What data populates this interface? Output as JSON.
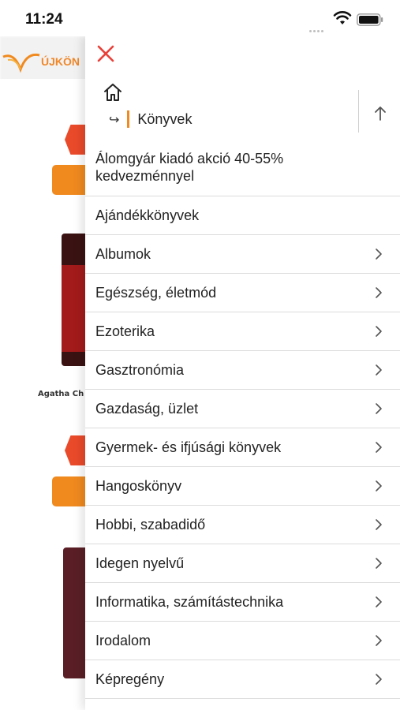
{
  "status_bar": {
    "time": "11:24"
  },
  "background": {
    "logo_text": "ÚJKÖN",
    "product_author": "Agatha Ch"
  },
  "drawer": {
    "breadcrumb": {
      "current": "Könyvek"
    },
    "categories": [
      {
        "label": "Álomgyár kiadó akció 40-55% kedvezménnyel",
        "has_children": false
      },
      {
        "label": "Ajándékkönyvek",
        "has_children": false
      },
      {
        "label": "Albumok",
        "has_children": true
      },
      {
        "label": "Egészség, életmód",
        "has_children": true
      },
      {
        "label": "Ezoterika",
        "has_children": true
      },
      {
        "label": "Gasztronómia",
        "has_children": true
      },
      {
        "label": "Gazdaság, üzlet",
        "has_children": true
      },
      {
        "label": "Gyermek- és ifjúsági könyvek",
        "has_children": true
      },
      {
        "label": "Hangoskönyv",
        "has_children": true
      },
      {
        "label": "Hobbi, szabadidő",
        "has_children": true
      },
      {
        "label": "Idegen nyelvű",
        "has_children": true
      },
      {
        "label": "Informatika, számítástechnika",
        "has_children": true
      },
      {
        "label": "Irodalom",
        "has_children": true
      },
      {
        "label": "Képregény",
        "has_children": true
      }
    ]
  },
  "colors": {
    "accent": "#f08a1f",
    "close": "#e8413a",
    "divider": "#dcdcdc"
  },
  "icons": {
    "close": "close-icon",
    "home": "home-icon",
    "breadcrumb_arrow": "return-arrow-icon",
    "up": "arrow-up-icon",
    "chevron": "chevron-right-icon"
  }
}
